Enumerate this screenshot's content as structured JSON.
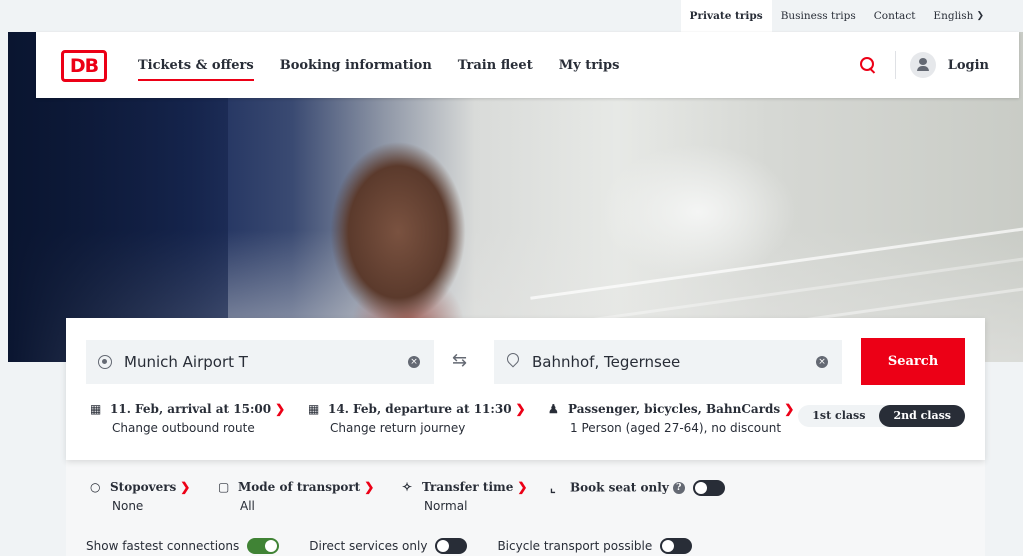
{
  "util_bar": {
    "items": [
      "Private trips",
      "Business trips",
      "Contact"
    ],
    "language": "English"
  },
  "header": {
    "logo": "DB",
    "nav": [
      "Tickets & offers",
      "Booking information",
      "Train fleet",
      "My trips"
    ],
    "login": "Login"
  },
  "booking": {
    "origin": "Munich Airport T",
    "destination": "Bahnhof, Tegernsee",
    "search_label": "Search",
    "outbound": {
      "title": "11. Feb, arrival at 15:00",
      "sub": "Change outbound route"
    },
    "return": {
      "title": "14. Feb, departure at 11:30",
      "sub": "Change return journey"
    },
    "passengers": {
      "title": "Passenger, bicycles, BahnCards",
      "sub": "1 Person (aged 27-64), no discount"
    },
    "classes": [
      "1st class",
      "2nd class"
    ],
    "selected_class": "2nd class"
  },
  "options": {
    "stopovers": {
      "title": "Stopovers",
      "value": "None"
    },
    "transport": {
      "title": "Mode of transport",
      "value": "All"
    },
    "transfer": {
      "title": "Transfer time",
      "value": "Normal"
    },
    "seat_only": {
      "title": "Book seat only",
      "on": false
    },
    "fastest": {
      "label": "Show fastest connections",
      "on": true
    },
    "direct": {
      "label": "Direct services only",
      "on": false
    },
    "bicycle": {
      "label": "Bicycle transport possible",
      "on": false
    }
  },
  "colors": {
    "accent": "#ec0016",
    "dark": "#282d37",
    "toggle_on": "#408335"
  }
}
